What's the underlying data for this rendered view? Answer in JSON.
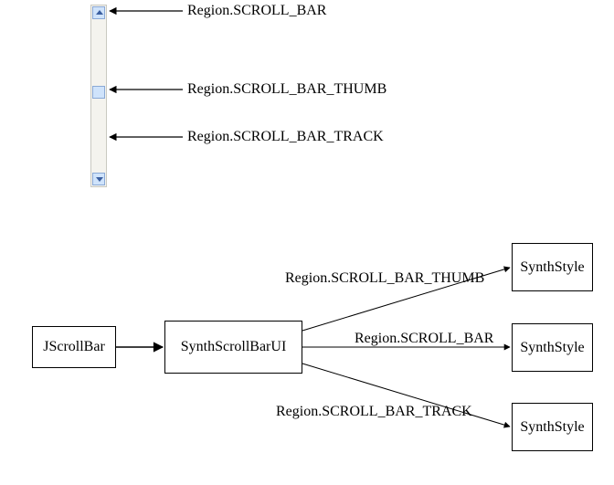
{
  "callouts": {
    "scroll_bar": "Region.SCROLL_BAR",
    "scroll_bar_thumb": "Region.SCROLL_BAR_THUMB",
    "scroll_bar_track": "Region.SCROLL_BAR_TRACK"
  },
  "nodes": {
    "jscrollbar": "JScrollBar",
    "synthscrollbarui": "SynthScrollBarUI",
    "synthstyle_top": "SynthStyle",
    "synthstyle_mid": "SynthStyle",
    "synthstyle_bot": "SynthStyle"
  },
  "edges": {
    "thumb": "Region.SCROLL_BAR_THUMB",
    "bar": "Region.SCROLL_BAR",
    "track": "Region.SCROLL_BAR_TRACK"
  }
}
